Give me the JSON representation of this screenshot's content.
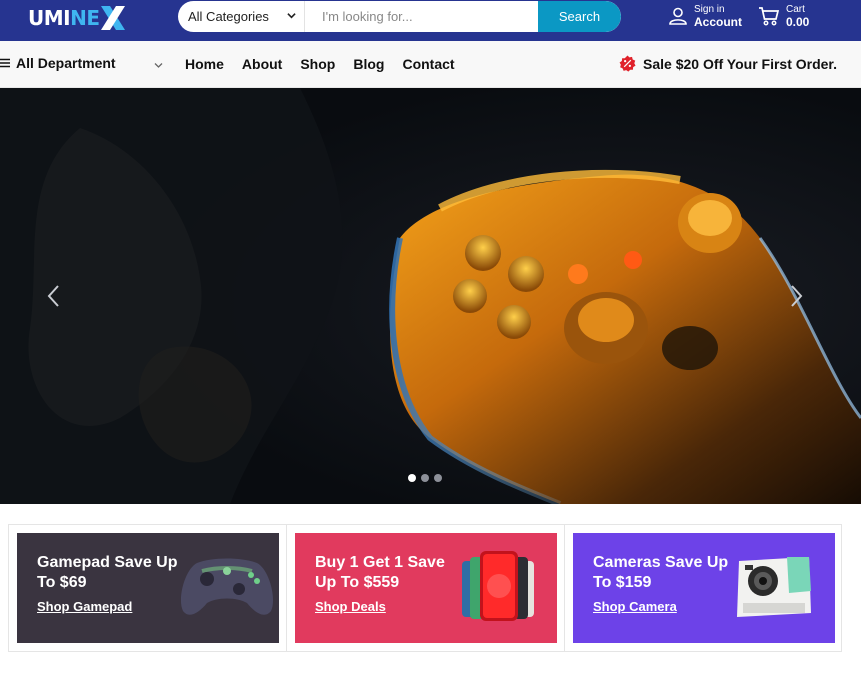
{
  "brand": {
    "logo_main": "UMINE",
    "logo_x": "X"
  },
  "search": {
    "category": "All Categories",
    "placeholder": "I'm looking for...",
    "button": "Search"
  },
  "account": {
    "top": "Sign in",
    "bottom": "Account"
  },
  "cart": {
    "top": "Cart",
    "bottom": "0.00"
  },
  "nav": {
    "department": "All Department",
    "items": [
      {
        "label": "Home"
      },
      {
        "label": "About"
      },
      {
        "label": "Shop"
      },
      {
        "label": "Blog"
      },
      {
        "label": "Contact"
      }
    ],
    "promo": "Sale $20 Off Your First Order."
  },
  "hero": {
    "slides": 3,
    "active_slide": 1
  },
  "cards": [
    {
      "title": "Gamepad Save Up To $69",
      "link": "Shop Gamepad",
      "color": "#3a3440"
    },
    {
      "title": "Buy 1 Get 1 Save Up To $559",
      "link": "Shop Deals",
      "color": "#e13a5e"
    },
    {
      "title": "Cameras Save Up To $159",
      "link": "Shop Camera",
      "color": "#6d42e8"
    }
  ],
  "colors": {
    "header": "#263490",
    "search_button": "#0b98c4",
    "logo_accent": "#3fb5f0",
    "promo_badge": "#e0222b"
  }
}
